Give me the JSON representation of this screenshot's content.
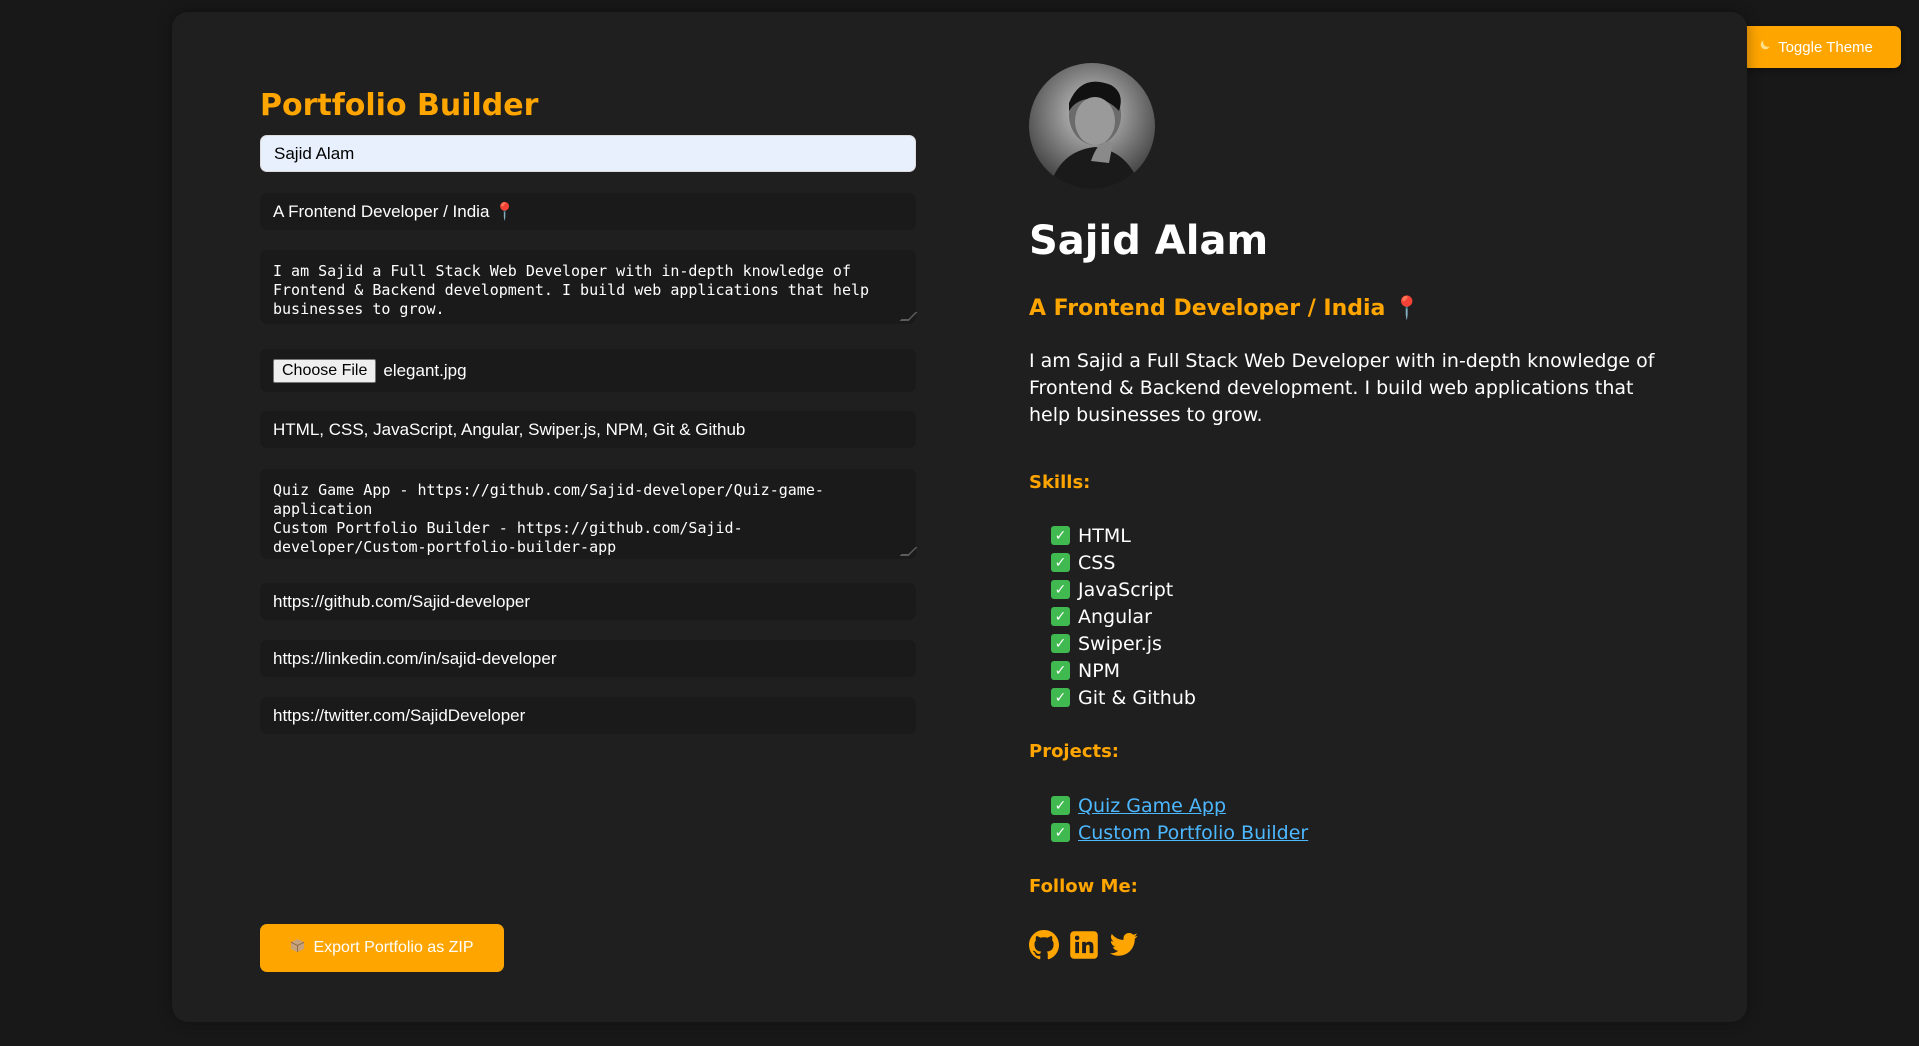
{
  "header": {
    "toggle_label": "Toggle Theme",
    "toggle_icon": "moon-icon"
  },
  "colors": {
    "accent": "#ffa500",
    "background": "#181818",
    "card": "#1f1f1f",
    "link": "#4db8ff",
    "check": "#3fb950"
  },
  "form": {
    "title": "Portfolio Builder",
    "name_value": "Sajid Alam",
    "tagline_value": "A Frontend Developer / India 📍",
    "bio_value": "I am Sajid a Full Stack Web Developer with in-depth knowledge of\nFrontend & Backend development. I build web applications that help\nbusinesses to grow.",
    "file_button": "Choose File",
    "file_name": "elegant.jpg",
    "skills_value": "HTML, CSS, JavaScript, Angular, Swiper.js, NPM, Git & Github",
    "projects_value": "Quiz Game App - https://github.com/Sajid-developer/Quiz-game-\napplication\nCustom Portfolio Builder - https://github.com/Sajid-\ndeveloper/Custom-portfolio-builder-app",
    "github_value": "https://github.com/Sajid-developer",
    "linkedin_value": "https://linkedin.com/in/sajid-developer",
    "twitter_value": "https://twitter.com/SajidDeveloper",
    "export_label": "Export Portfolio as ZIP",
    "export_icon": "package-icon"
  },
  "preview": {
    "name": "Sajid Alam",
    "tagline": "A Frontend Developer / India 📍",
    "bio": "I am Sajid a Full Stack Web Developer with in-depth knowledge of Frontend & Backend development. I build web applications that help businesses to grow.",
    "skills_heading": "Skills:",
    "skills": [
      "HTML",
      "CSS",
      "JavaScript",
      "Angular",
      "Swiper.js",
      "NPM",
      "Git & Github"
    ],
    "projects_heading": "Projects:",
    "projects": [
      "Quiz Game App",
      "Custom Portfolio Builder"
    ],
    "follow_heading": "Follow Me:",
    "socials": [
      "github-icon",
      "linkedin-icon",
      "twitter-icon"
    ]
  }
}
